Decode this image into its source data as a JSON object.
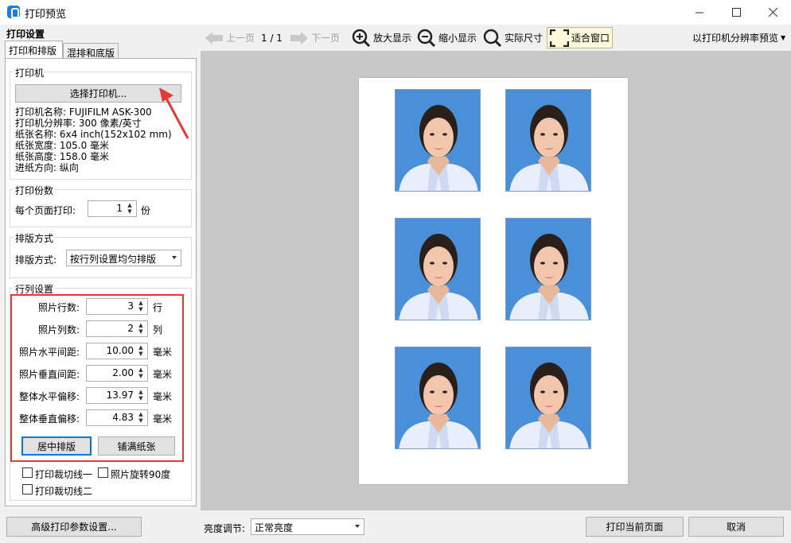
{
  "window": {
    "title": "打印预览"
  },
  "panel_header": "打印设置",
  "tabs": [
    {
      "label": "打印和排版"
    },
    {
      "label": "混排和底版"
    }
  ],
  "printer_group": {
    "title": "打印机",
    "select_button": "选择打印机...",
    "info": [
      "打印机名称: FUJIFILM ASK-300",
      "打印机分辨率: 300 像素/英寸",
      "纸张名称: 6x4 inch(152x102 mm)",
      "纸张宽度: 105.0 毫米",
      "纸张高度: 158.0 毫米",
      "进纸方向: 纵向"
    ]
  },
  "copies_group": {
    "title": "打印份数",
    "label": "每个页面打印:",
    "value": "1",
    "unit": "份"
  },
  "layout_group": {
    "title": "排版方式",
    "label": "排版方式:",
    "value": "按行列设置均匀排版"
  },
  "rowcol_group": {
    "title": "行列设置",
    "rows": [
      {
        "label": "照片行数:",
        "value": "3",
        "unit": "行"
      },
      {
        "label": "照片列数:",
        "value": "2",
        "unit": "列"
      },
      {
        "label": "照片水平间距:",
        "value": "10.00",
        "unit": "毫米"
      },
      {
        "label": "照片垂直间距:",
        "value": "2.00",
        "unit": "毫米"
      },
      {
        "label": "整体水平偏移:",
        "value": "13.97",
        "unit": "毫米"
      },
      {
        "label": "整体垂直偏移:",
        "value": "4.83",
        "unit": "毫米"
      }
    ],
    "center_button": "居中排版",
    "fill_button": "铺满纸张"
  },
  "checkboxes": [
    {
      "label": "打印裁切线一",
      "checked": false
    },
    {
      "label": "照片旋转90度",
      "checked": false
    },
    {
      "label": "打印裁切线二",
      "checked": false
    }
  ],
  "toolbar": {
    "prev": "上一页",
    "page": "1 / 1",
    "next": "下一页",
    "zoom_in": "放大显示",
    "zoom_out": "缩小显示",
    "actual": "实际尺寸",
    "fit": "适合窗口",
    "preview_mode": "以打印机分辨率预览"
  },
  "bottom": {
    "advanced": "高级打印参数设置...",
    "brightness_label": "亮度调节:",
    "brightness_value": "正常亮度",
    "print_button": "打印当前页面",
    "cancel_button": "取消"
  },
  "colors": {
    "accent": "#0078d7",
    "highlight": "#e53935",
    "photo_bg": "#4a90d9"
  }
}
